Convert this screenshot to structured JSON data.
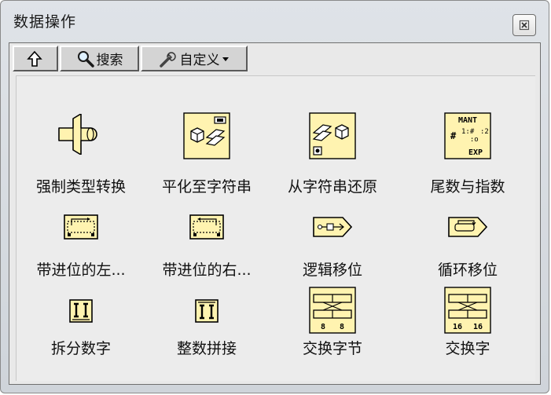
{
  "window": {
    "title": "数据操作"
  },
  "toolbar": {
    "up_icon": "up-arrow-icon",
    "search_label": "搜索",
    "custom_label": "自定义"
  },
  "items": [
    {
      "label": "强制类型转换",
      "icon": "type-cast-icon"
    },
    {
      "label": "平化至字符串",
      "icon": "flatten-to-string-icon"
    },
    {
      "label": "从字符串还原",
      "icon": "unflatten-from-string-icon"
    },
    {
      "label": "尾数与指数",
      "icon": "mantissa-exponent-icon"
    },
    {
      "label": "带进位的左...",
      "icon": "rotate-left-with-carry-icon"
    },
    {
      "label": "带进位的右...",
      "icon": "rotate-right-with-carry-icon"
    },
    {
      "label": "逻辑移位",
      "icon": "logical-shift-icon"
    },
    {
      "label": "循环移位",
      "icon": "rotate-icon"
    },
    {
      "label": "拆分数字",
      "icon": "split-number-icon"
    },
    {
      "label": "整数拼接",
      "icon": "join-numbers-icon"
    },
    {
      "label": "交换字节",
      "icon": "swap-bytes-icon"
    },
    {
      "label": "交换字",
      "icon": "swap-words-icon"
    }
  ],
  "icon_texts": {
    "mant": "MANT",
    "exp": "EXP",
    "swap_bytes_a": "8",
    "swap_bytes_b": "8",
    "swap_words_a": "16",
    "swap_words_b": "16"
  },
  "colors": {
    "icon_fill": "#fff3b0",
    "icon_border": "#000000"
  }
}
